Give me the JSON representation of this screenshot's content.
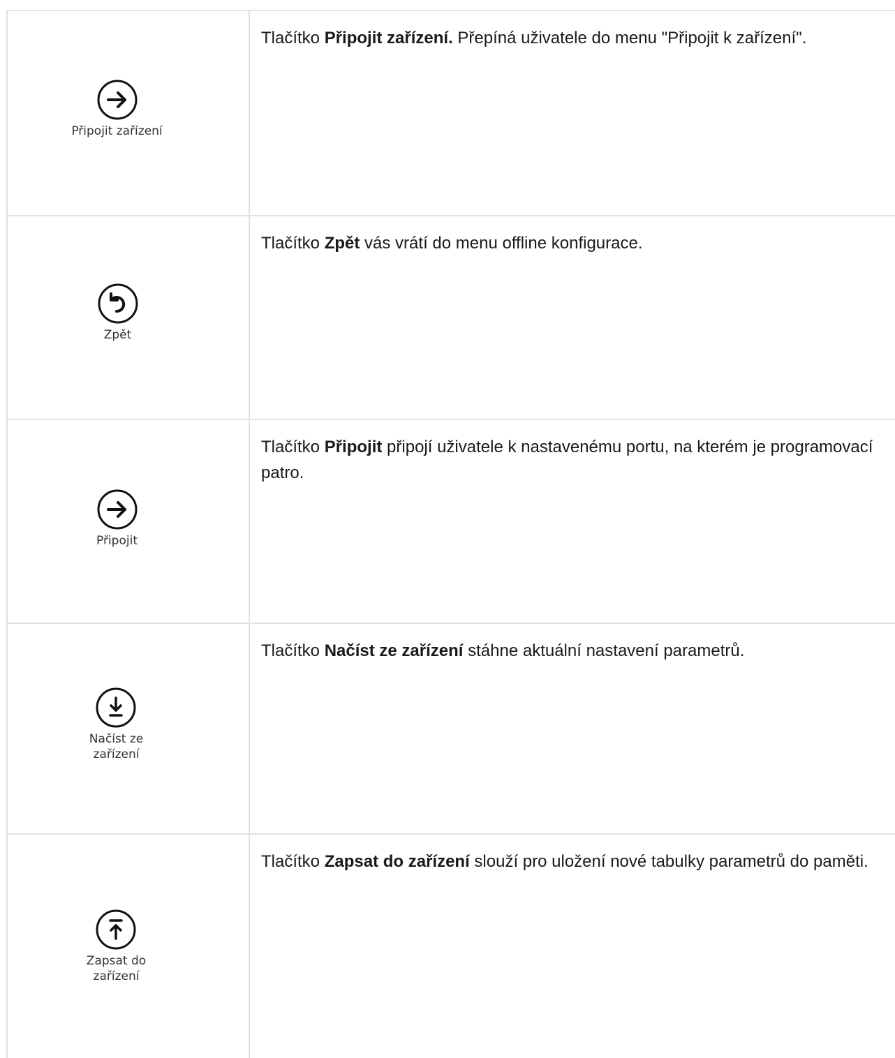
{
  "rows": [
    {
      "icon": "arrow-right-circle-icon",
      "button_label": "Připojit zařízení",
      "desc_prefix": "Tlačítko ",
      "desc_bold": "Připojit zařízení.",
      "desc_suffix": " Přepíná uživatele do menu \"Připojit k zařízení\"."
    },
    {
      "icon": "undo-circle-icon",
      "button_label": "Zpět",
      "desc_prefix": "Tlačítko ",
      "desc_bold": "Zpět",
      "desc_suffix": " vás vrátí do menu offline konfigurace."
    },
    {
      "icon": "arrow-right-circle-icon",
      "button_label": "Připojit",
      "desc_prefix": "Tlačítko ",
      "desc_bold": "Připojit",
      "desc_suffix": " připojí uživatele k nastavenému portu, na kterém je programovací patro."
    },
    {
      "icon": "download-circle-icon",
      "button_label": "Načíst ze\nzařízení",
      "desc_prefix": "Tlačítko ",
      "desc_bold": "Načíst ze zařízení",
      "desc_suffix": " stáhne aktuální nastavení parametrů."
    },
    {
      "icon": "upload-circle-icon",
      "button_label": "Zapsat do\nzařízení",
      "desc_prefix": "Tlačítko ",
      "desc_bold": "Zapsat do zařízení",
      "desc_suffix": " slouží pro uložení nové tabulky parametrů do paměti."
    }
  ]
}
